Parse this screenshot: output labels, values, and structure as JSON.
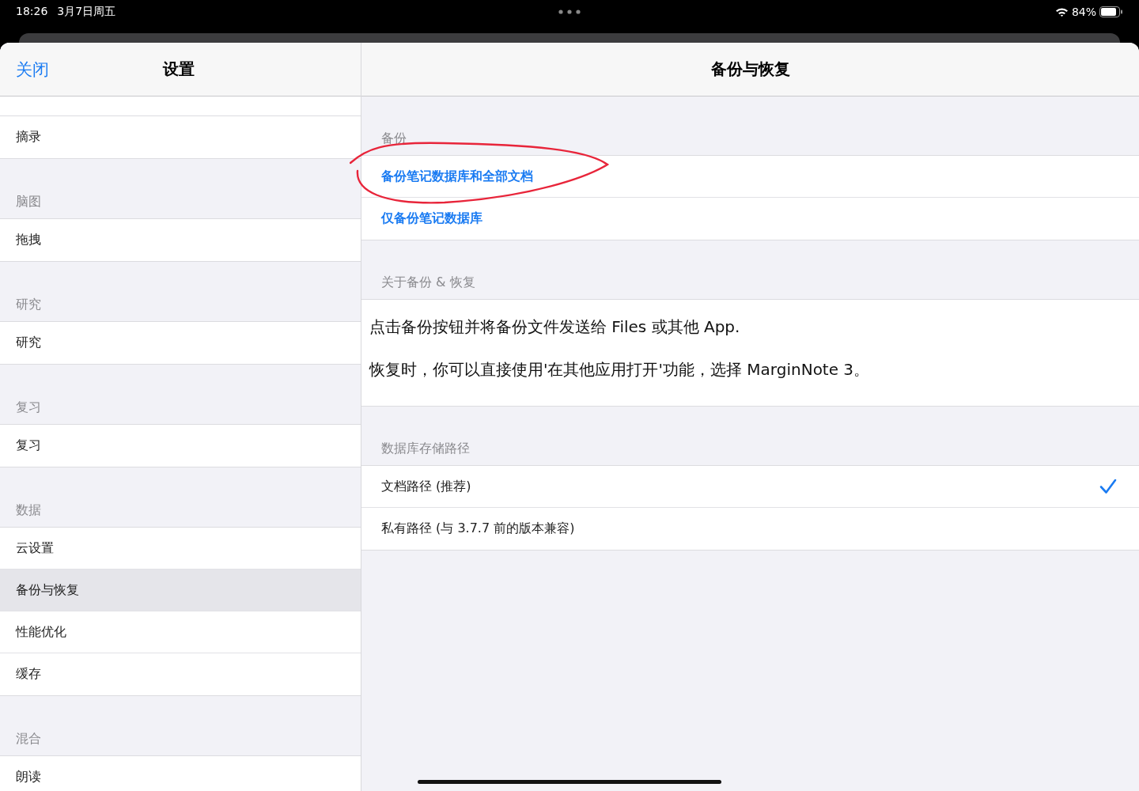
{
  "status_bar": {
    "time": "18:26",
    "date": "3月7日周五",
    "battery": "84%"
  },
  "sidebar": {
    "close": "关闭",
    "title": "设置",
    "sections": [
      {
        "items": [
          {
            "label": "摘录",
            "selected": false
          }
        ]
      },
      {
        "header": "脑图",
        "items": [
          {
            "label": "拖拽",
            "selected": false
          }
        ]
      },
      {
        "header": "研究",
        "items": [
          {
            "label": "研究",
            "selected": false
          }
        ]
      },
      {
        "header": "复习",
        "items": [
          {
            "label": "复习",
            "selected": false
          }
        ]
      },
      {
        "header": "数据",
        "items": [
          {
            "label": "云设置",
            "selected": false
          },
          {
            "label": "备份与恢复",
            "selected": true
          },
          {
            "label": "性能优化",
            "selected": false
          },
          {
            "label": "缓存",
            "selected": false
          }
        ]
      },
      {
        "header": "混合",
        "items": [
          {
            "label": "朗读",
            "selected": false
          }
        ]
      }
    ]
  },
  "detail": {
    "title": "备份与恢复",
    "groups": [
      {
        "header": "备份",
        "kind": "actions",
        "rows": [
          {
            "label": "备份笔记数据库和全部文档",
            "highlighted": true
          },
          {
            "label": "仅备份笔记数据库",
            "highlighted": false
          }
        ]
      },
      {
        "header": "关于备份 & 恢复",
        "kind": "text",
        "paragraphs": [
          "点击备份按钮并将备份文件发送给 Files 或其他 App.",
          "恢复时，你可以直接使用'在其他应用打开'功能，选择 MarginNote 3。"
        ]
      },
      {
        "header": "数据库存储路径",
        "kind": "options",
        "rows": [
          {
            "label": "文档路径 (推荐)",
            "selected": true
          },
          {
            "label": "私有路径 (与 3.7.7 前的版本兼容)",
            "selected": false
          }
        ]
      }
    ]
  }
}
